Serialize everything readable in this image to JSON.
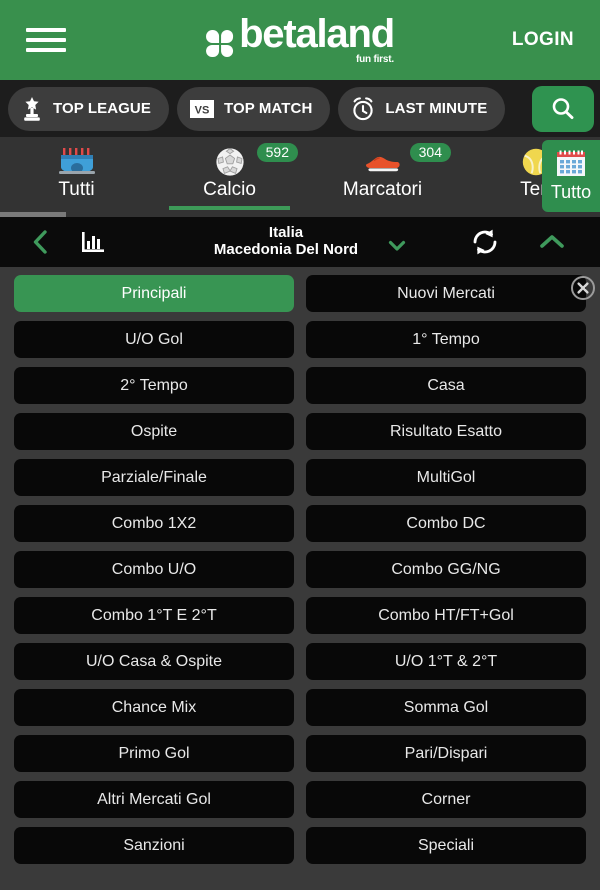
{
  "header": {
    "menu_icon": "hamburger-icon",
    "brand_name": "betaland",
    "brand_tagline": "fun first.",
    "login_label": "LOGIN"
  },
  "quick_filters": [
    {
      "label": "TOP LEAGUE",
      "icon": "trophy-icon"
    },
    {
      "label": "TOP MATCH",
      "icon": "vs-icon"
    },
    {
      "label": "LAST MINUTE",
      "icon": "alarm-clock-icon"
    }
  ],
  "search": {
    "icon": "search-icon"
  },
  "sports": {
    "items": [
      {
        "label": "Tutti",
        "icon": "stadium-icon",
        "badge": "",
        "active": false
      },
      {
        "label": "Calcio",
        "icon": "soccer-ball-icon",
        "badge": "592",
        "active": true
      },
      {
        "label": "Marcatori",
        "icon": "football-boot-icon",
        "badge": "304",
        "active": false
      },
      {
        "label": "Ten",
        "icon": "tennis-ball-icon",
        "badge": "",
        "active": false
      }
    ],
    "all_button": {
      "label": "Tutto",
      "icon": "calendar-icon"
    }
  },
  "event_bar": {
    "back_icon": "chevron-left-icon",
    "stats_icon": "bar-chart-icon",
    "home_team": "Italia",
    "away_team": "Macedonia Del Nord",
    "dropdown_icon": "chevron-down-icon",
    "refresh_icon": "refresh-icon",
    "collapse_icon": "chevron-up-icon"
  },
  "markets_panel": {
    "close_icon": "close-circle-icon",
    "items": [
      {
        "label": "Principali",
        "active": true
      },
      {
        "label": "Nuovi Mercati",
        "active": false
      },
      {
        "label": "U/O Gol",
        "active": false
      },
      {
        "label": "1° Tempo",
        "active": false
      },
      {
        "label": "2° Tempo",
        "active": false
      },
      {
        "label": "Casa",
        "active": false
      },
      {
        "label": "Ospite",
        "active": false
      },
      {
        "label": "Risultato Esatto",
        "active": false
      },
      {
        "label": "Parziale/Finale",
        "active": false
      },
      {
        "label": "MultiGol",
        "active": false
      },
      {
        "label": "Combo 1X2",
        "active": false
      },
      {
        "label": "Combo DC",
        "active": false
      },
      {
        "label": "Combo U/O",
        "active": false
      },
      {
        "label": "Combo GG/NG",
        "active": false
      },
      {
        "label": "Combo 1°T E 2°T",
        "active": false
      },
      {
        "label": "Combo HT/FT+Gol",
        "active": false
      },
      {
        "label": "U/O Casa & Ospite",
        "active": false
      },
      {
        "label": "U/O 1°T & 2°T",
        "active": false
      },
      {
        "label": "Chance Mix",
        "active": false
      },
      {
        "label": "Somma Gol",
        "active": false
      },
      {
        "label": "Primo Gol",
        "active": false
      },
      {
        "label": "Pari/Dispari",
        "active": false
      },
      {
        "label": "Altri Mercati Gol",
        "active": false
      },
      {
        "label": "Corner",
        "active": false
      },
      {
        "label": "Sanzioni",
        "active": false
      },
      {
        "label": "Speciali",
        "active": false
      }
    ]
  },
  "colors": {
    "brand_green": "#39904d",
    "accent_green": "#2f8e4e",
    "panel_bg": "#3a3a3a",
    "button_bg": "#080808",
    "tabs_bg": "#333333",
    "pillbar_bg": "#1d1d1d"
  }
}
